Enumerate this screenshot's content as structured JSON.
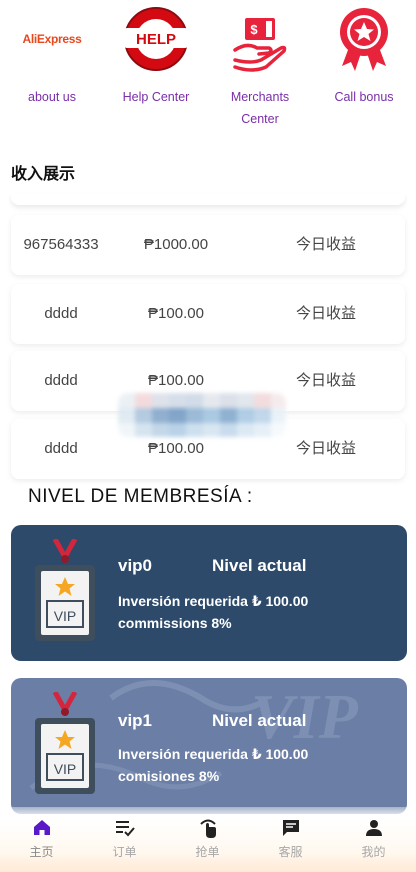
{
  "quick_links": [
    {
      "label": "about us",
      "logo_text_1": "Ali",
      "logo_text_2": "Express"
    },
    {
      "label": "Help Center",
      "icon_text": "HELP"
    },
    {
      "label": "Merchants Center",
      "icon_text": "$"
    },
    {
      "label": "Call bonus"
    }
  ],
  "income_section": {
    "title": "收入展示",
    "rows": [
      {
        "account": "967564333",
        "amount": "₱1000.00",
        "label": "今日收益"
      },
      {
        "account": "dddd",
        "amount": "₱100.00",
        "label": "今日收益"
      },
      {
        "account": "dddd",
        "amount": "₱100.00",
        "label": "今日收益"
      },
      {
        "account": "dddd",
        "amount": "₱100.00",
        "label": "今日收益"
      }
    ]
  },
  "membership": {
    "title": "NIVEL DE MEMBRESÍA :",
    "levels": [
      {
        "name": "vip0",
        "status": "Nivel actual",
        "requirement": "Inversión requerida ₺ 100.00",
        "commission": "commissions 8%",
        "badge_text": "VIP"
      },
      {
        "name": "vip1",
        "status": "Nivel actual",
        "requirement": "Inversión requerida ₺ 100.00",
        "commission": "comisiones 8%",
        "badge_text": "VIP"
      }
    ]
  },
  "bottom_nav": [
    {
      "label": "主页",
      "icon": "home-icon",
      "active": true
    },
    {
      "label": "订单",
      "icon": "order-list-icon"
    },
    {
      "label": "抢单",
      "icon": "grab-order-icon"
    },
    {
      "label": "客服",
      "icon": "customer-service-icon"
    },
    {
      "label": "我的",
      "icon": "profile-icon"
    }
  ],
  "colors": {
    "link_purple": "#7a2ea8",
    "vip0_card": "#2e4a6b",
    "vip1_card": "#6b7fa6",
    "nav_active": "#5a19c9"
  }
}
